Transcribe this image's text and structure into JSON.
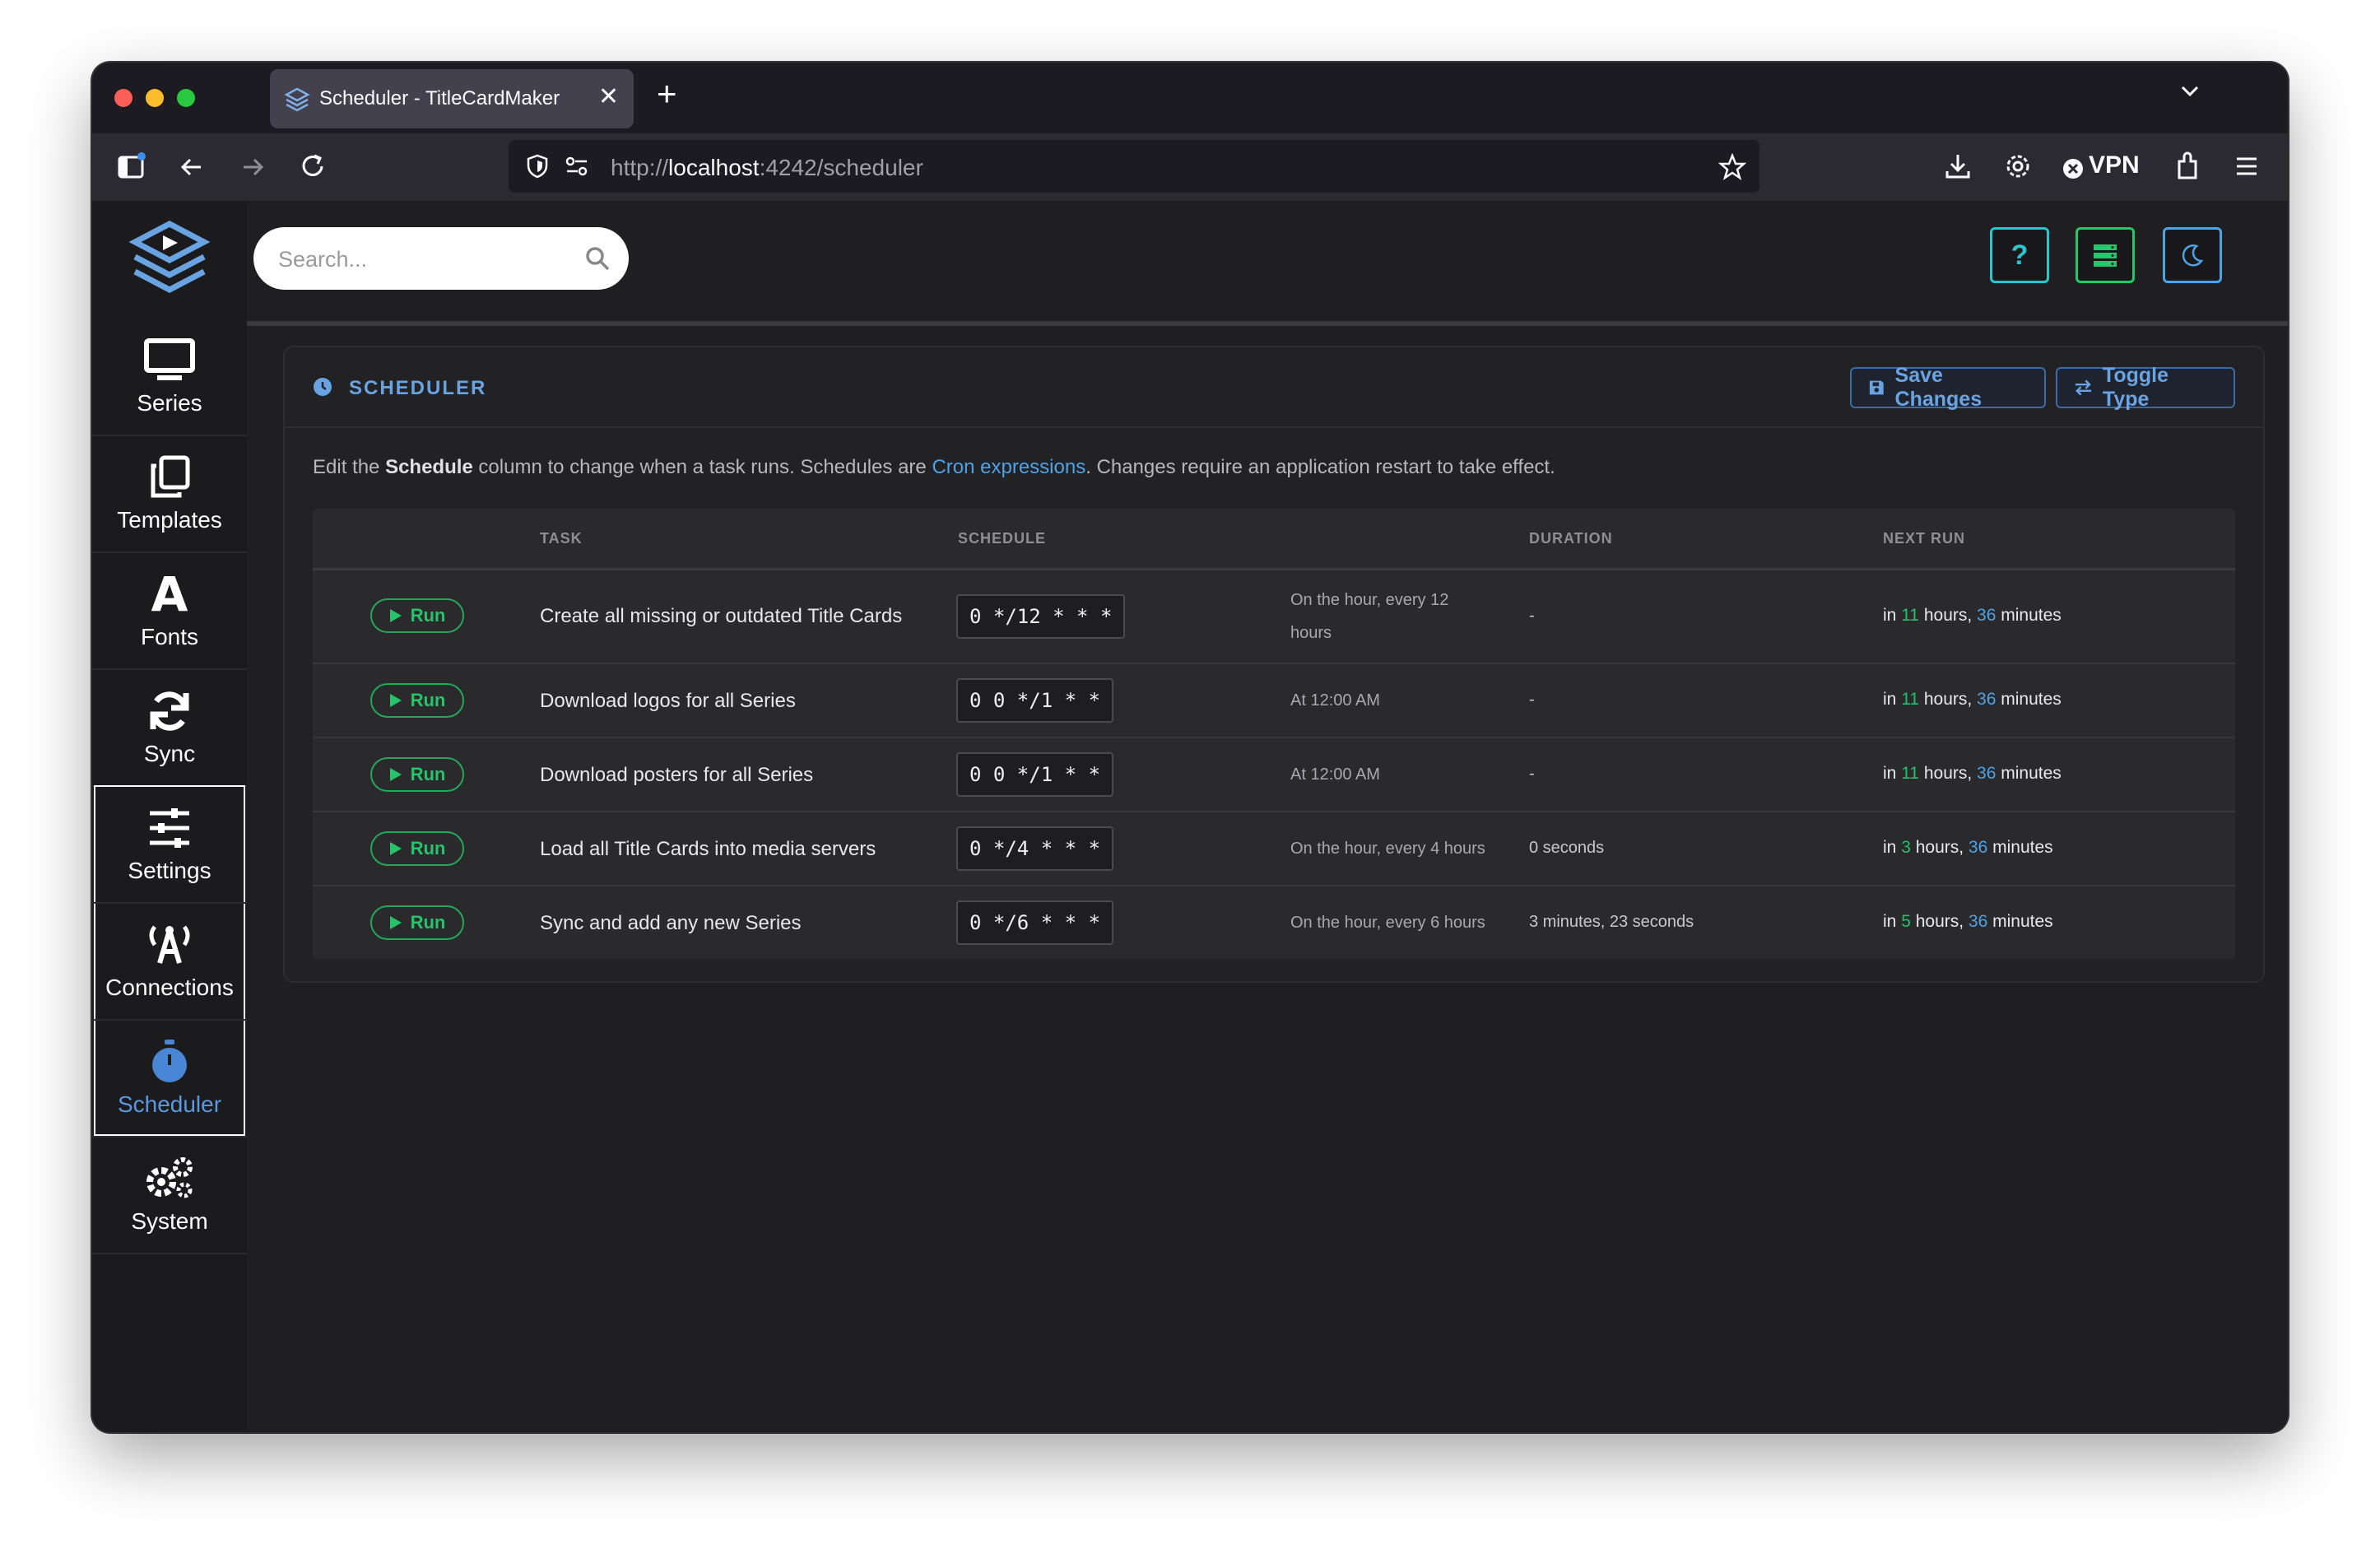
{
  "browser": {
    "tab_title": "Scheduler - TitleCardMaker",
    "url_prefix": "http://",
    "url_host": "localhost",
    "url_rest": ":4242/scheduler",
    "vpn_label": "VPN"
  },
  "sidebar": {
    "items": [
      {
        "label": "Series",
        "icon": "monitor-icon"
      },
      {
        "label": "Templates",
        "icon": "copy-icon"
      },
      {
        "label": "Fonts",
        "icon": "font-icon"
      },
      {
        "label": "Sync",
        "icon": "sync-icon"
      },
      {
        "label": "Settings",
        "icon": "sliders-icon"
      },
      {
        "label": "Connections",
        "icon": "broadcast-icon"
      },
      {
        "label": "Scheduler",
        "icon": "stopwatch-icon"
      },
      {
        "label": "System",
        "icon": "gears-icon"
      }
    ],
    "active": "Scheduler"
  },
  "topbar": {
    "search_placeholder": "Search...",
    "help_label": "?"
  },
  "card": {
    "title": "SCHEDULER",
    "save_label": "Save Changes",
    "toggle_label": "Toggle Type",
    "desc_1": "Edit the ",
    "desc_strong": "Schedule",
    "desc_2": " column to change when a task runs. Schedules are ",
    "desc_link": "Cron expressions",
    "desc_3": ". Changes require an application restart to take effect."
  },
  "table": {
    "headers": {
      "task": "TASK",
      "schedule": "SCHEDULE",
      "duration": "DURATION",
      "next_run": "NEXT RUN"
    },
    "run_label": "Run",
    "rows": [
      {
        "task": "Create all missing or outdated Title Cards",
        "cron": "0 */12 * * *",
        "human_1": "On the hour, every 12",
        "human_2": "hours",
        "duration": "-",
        "in": "in ",
        "hours": "11",
        "hours_label": " hours, ",
        "minutes": "36",
        "minutes_label": " minutes"
      },
      {
        "task": "Download logos for all Series",
        "cron": "0 0 */1 * *",
        "human_1": "At 12:00 AM",
        "human_2": "",
        "duration": "-",
        "in": "in ",
        "hours": "11",
        "hours_label": " hours, ",
        "minutes": "36",
        "minutes_label": " minutes"
      },
      {
        "task": "Download posters for all Series",
        "cron": "0 0 */1 * *",
        "human_1": "At 12:00 AM",
        "human_2": "",
        "duration": "-",
        "in": "in ",
        "hours": "11",
        "hours_label": " hours, ",
        "minutes": "36",
        "minutes_label": " minutes"
      },
      {
        "task": "Load all Title Cards into media servers",
        "cron": "0 */4 * * *",
        "human_1": "On the hour, every 4 hours",
        "human_2": "",
        "duration": "0 seconds",
        "in": "in ",
        "hours": "3",
        "hours_label": " hours, ",
        "minutes": "36",
        "minutes_label": " minutes"
      },
      {
        "task": "Sync and add any new Series",
        "cron": "0 */6 * * *",
        "human_1": "On the hour, every 6 hours",
        "human_2": "",
        "duration": "3 minutes, 23 seconds",
        "in": "in ",
        "hours": "5",
        "hours_label": " hours, ",
        "minutes": "36",
        "minutes_label": " minutes"
      }
    ]
  },
  "colors": {
    "accent_blue": "#4ea2e6",
    "run_green": "#26c36a",
    "help_cyan": "#2ec4cc"
  }
}
